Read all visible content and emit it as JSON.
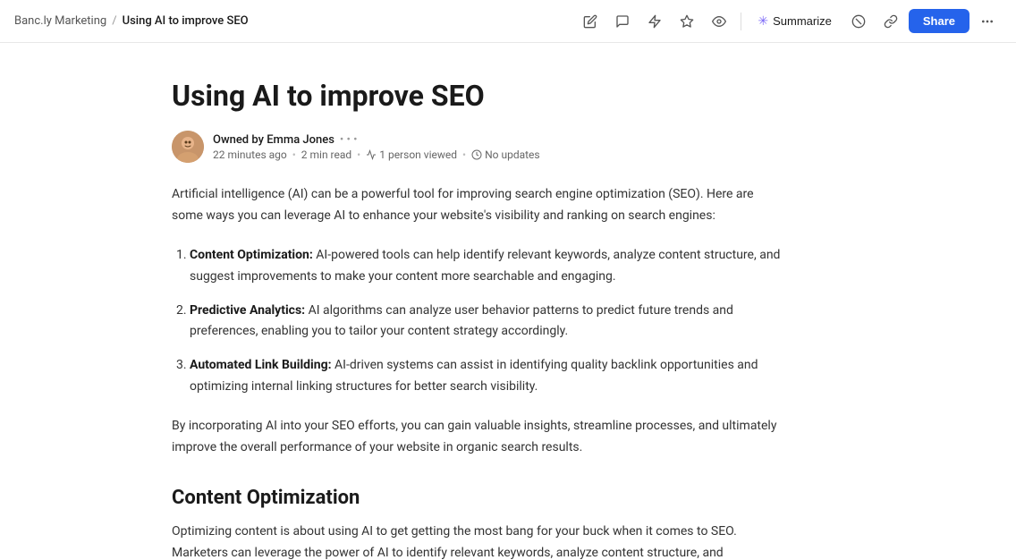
{
  "breadcrumb": {
    "root": "Banc.ly Marketing",
    "separator": "/",
    "current": "Using AI to improve SEO"
  },
  "toolbar": {
    "summarize_label": "Summarize",
    "share_label": "Share"
  },
  "page": {
    "title": "Using AI to improve SEO",
    "owner": "Owned by Emma Jones",
    "timestamp": "22 minutes ago",
    "read_time": "2 min read",
    "viewers": "1 person viewed",
    "updates": "No updates",
    "intro": "Artificial intelligence (AI) can be a powerful tool for improving search engine optimization (SEO). Here are some ways you can leverage AI to enhance your website's visibility and ranking on search engines:",
    "list_items": [
      {
        "label": "Content Optimization:",
        "text": " AI-powered tools can help identify relevant keywords, analyze content structure, and suggest improvements to make your content more searchable and engaging."
      },
      {
        "label": "Predictive Analytics:",
        "text": " AI algorithms can analyze user behavior patterns to predict future trends and preferences, enabling you to tailor your content strategy accordingly."
      },
      {
        "label": "Automated Link Building:",
        "text": " AI-driven systems can assist in identifying quality backlink opportunities and optimizing internal linking structures for better search visibility."
      }
    ],
    "conclusion": "By incorporating AI into your SEO efforts, you can gain valuable insights, streamline processes, and ultimately improve the overall performance of your website in organic search results.",
    "section_title": "Content Optimization",
    "section_text": "Optimizing content is about using AI to get getting the most bang for your buck when it comes to SEO. Marketers can leverage the power of AI to identify relevant keywords, analyze content structure, and"
  }
}
